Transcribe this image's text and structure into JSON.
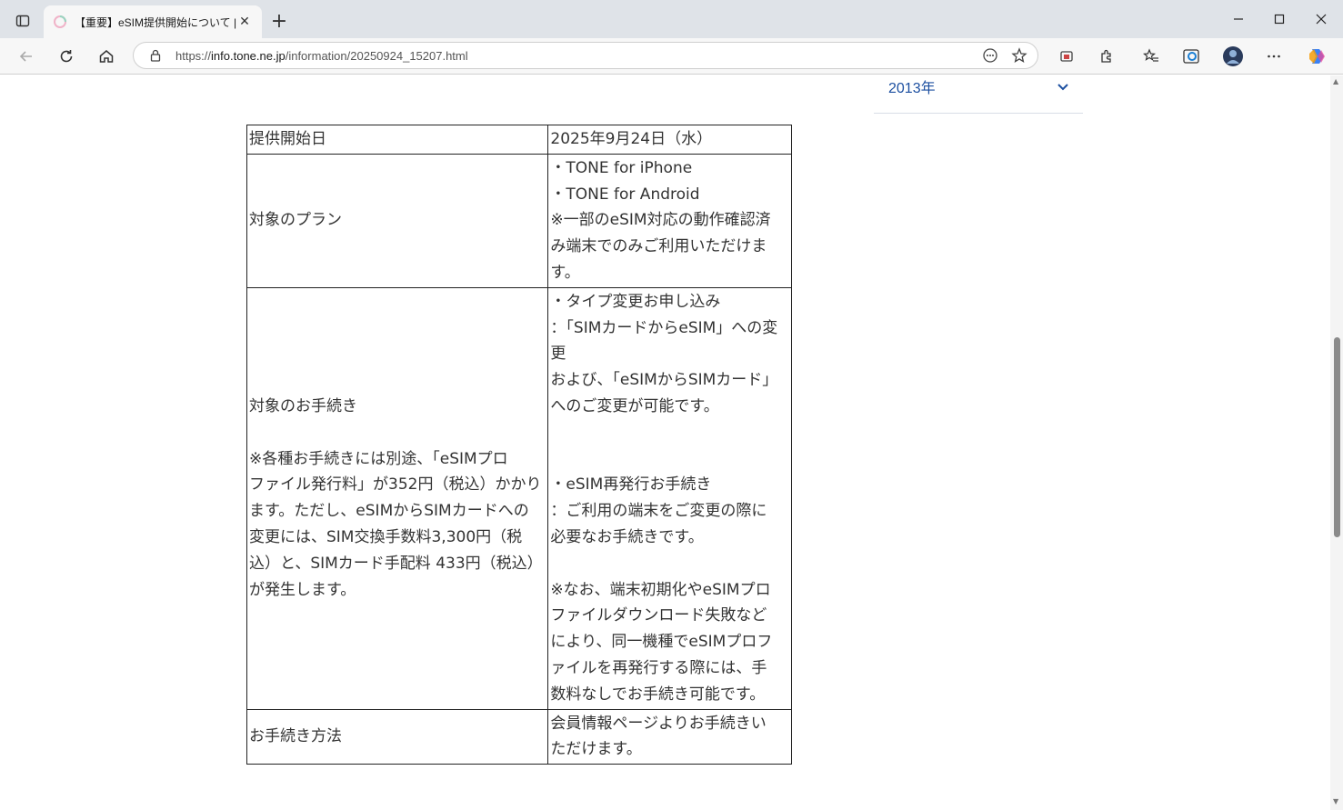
{
  "browser": {
    "tab_title": "【重要】eSIM提供開始について | お知",
    "tab_close": "✕",
    "new_tab": "+",
    "url_scheme": "https://",
    "url_host": "info.tone.ne.jp",
    "url_path": "/information/20250924_15207.html"
  },
  "sidebar": {
    "year": "2013年"
  },
  "table": {
    "rows": [
      {
        "label_lines": [
          "提供開始日"
        ],
        "value_lines": [
          "2025年9月24日（水）"
        ]
      },
      {
        "label_lines": [
          "対象のプラン"
        ],
        "value_lines": [
          "・TONE for iPhone",
          "・TONE for Android",
          "※一部のeSIM対応の動作確認済",
          "み端末でのみご利用いただけま",
          "す。"
        ]
      },
      {
        "label_lines": [
          "対象のお手続き",
          "",
          "※各種お手続きには別途、「eSIMプロ",
          "ファイル発行料」が352円（税込）かかり",
          "ます。ただし、eSIMからSIMカードへの",
          "変更には、SIM交換手数料3,300円（税",
          "込）と、SIMカード手配料 433円（税込）",
          "が発生します。"
        ],
        "value_lines": [
          "・タイプ変更お申し込み",
          "：「SIMカードからeSIM」への変",
          "更",
          "および、「eSIMからSIMカード」",
          "へのご変更が可能です。",
          "",
          "",
          "・eSIM再発行お手続き",
          "：ご利用の端末をご変更の際に",
          "必要なお手続きです。",
          "",
          "※なお、端末初期化やeSIMプロ",
          "ファイルダウンロード失敗など",
          "により、同一機種でeSIMプロフ",
          "ァイルを再発行する際には、手",
          "数料なしでお手続き可能です。"
        ]
      },
      {
        "label_lines": [
          "お手続き方法"
        ],
        "value_lines": [
          "会員情報ページよりお手続きい",
          "ただけます。"
        ]
      }
    ]
  },
  "colors": {
    "link_blue": "#1c4fa0",
    "table_border": "#222222",
    "text": "#333333"
  }
}
